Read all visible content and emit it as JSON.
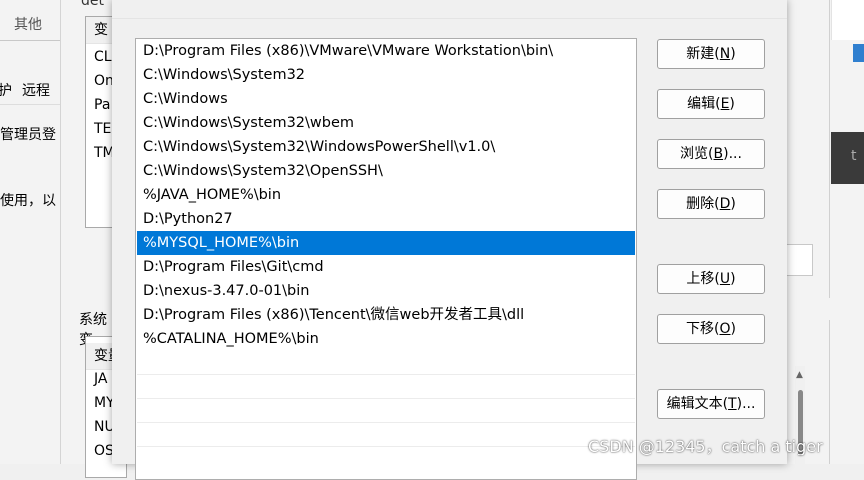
{
  "background_left": {
    "top_fragment": "其他",
    "tab_fragments": [
      "护",
      "远程"
    ],
    "text_fragment_1": "管理员登",
    "text_fragment_2": "使用，以",
    "mid_top_fragment": "det",
    "user_vars_header": "变",
    "user_vars": [
      "CL",
      "On",
      "Pa",
      "TE",
      "TM"
    ],
    "system_vars_label": "系统变",
    "system_vars_header": "变量",
    "system_vars": [
      "JA",
      "MY",
      "NU",
      "OS"
    ]
  },
  "background_right": {
    "dark_fragment": "t"
  },
  "dialog": {
    "path_entries": [
      "D:\\Program Files (x86)\\VMware\\VMware Workstation\\bin\\",
      "C:\\Windows\\System32",
      "C:\\Windows",
      "C:\\Windows\\System32\\wbem",
      "C:\\Windows\\System32\\WindowsPowerShell\\v1.0\\",
      "C:\\Windows\\System32\\OpenSSH\\",
      "%JAVA_HOME%\\bin",
      "D:\\Python27",
      "%MYSQL_HOME%\\bin",
      "D:\\Program Files\\Git\\cmd",
      "D:\\nexus-3.47.0-01\\bin",
      "D:\\Program Files (x86)\\Tencent\\微信web开发者工具\\dll",
      "%CATALINA_HOME%\\bin"
    ],
    "selected_index": 8,
    "buttons": {
      "new": {
        "label": "新建(",
        "key": "N",
        "tail": ")"
      },
      "edit": {
        "label": "编辑(",
        "key": "E",
        "tail": ")"
      },
      "browse": {
        "label": "浏览(",
        "key": "B",
        "tail": ")..."
      },
      "delete": {
        "label": "删除(",
        "key": "D",
        "tail": ")"
      },
      "move_up": {
        "label": "上移(",
        "key": "U",
        "tail": ")"
      },
      "move_down": {
        "label": "下移(",
        "key": "O",
        "tail": ")"
      },
      "edit_text": {
        "label": "编辑文本(",
        "key": "T",
        "tail": ")..."
      }
    }
  },
  "watermark": "CSDN @12345，catch a tiger"
}
